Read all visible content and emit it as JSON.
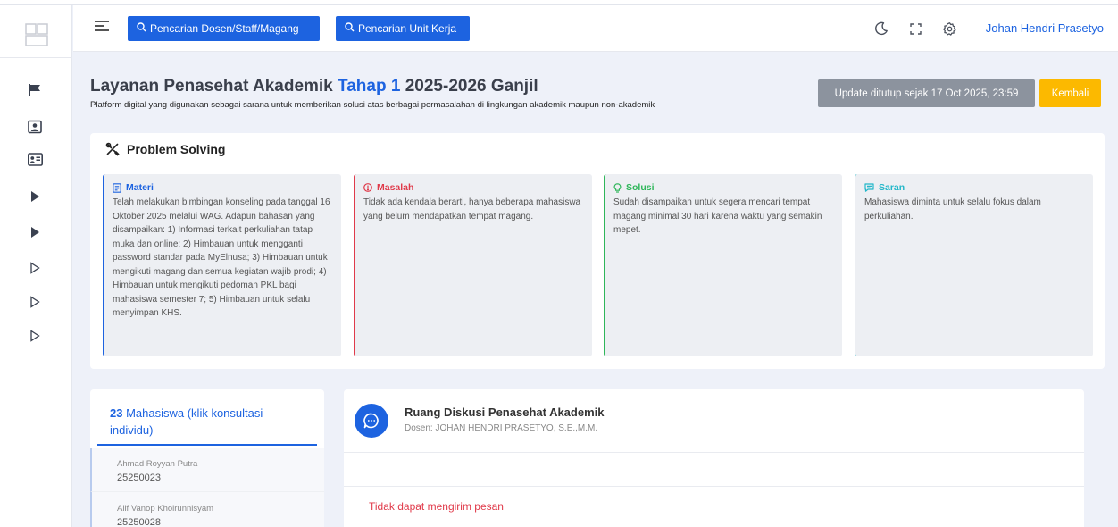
{
  "header": {
    "search_staff_label": "Pencarian Dosen/Staff/Magang",
    "search_unit_label": "Pencarian Unit Kerja",
    "username": "Johan Hendri Prasetyo"
  },
  "page": {
    "title_prefix": "Layanan Penasehat Akademik",
    "title_highlight": "Tahap 1",
    "title_suffix": "2025-2026 Ganjil",
    "subtitle": "Platform digital yang digunakan sebagai sarana untuk memberikan solusi atas berbagai permasalahan di lingkungan akademik maupun non-akademik",
    "closed_label": "Update ditutup sejak 17 Oct 2025, 23:59",
    "back_label": "Kembali"
  },
  "problem_solving": {
    "title": "Problem Solving",
    "materi": {
      "label": "Materi",
      "text": "Telah melakukan bimbingan konseling pada tanggal 16 Oktober 2025 melalui WAG. Adapun bahasan yang disampaikan: 1) Informasi terkait perkuliahan tatap muka dan online; 2) Himbauan untuk mengganti password standar pada MyElnusa; 3) Himbauan untuk mengikuti magang dan semua kegiatan wajib prodi; 4) Himbauan untuk mengikuti pedoman PKL bagi mahasiswa semester 7; 5) Himbauan untuk selalu menyimpan KHS."
    },
    "masalah": {
      "label": "Masalah",
      "text": "Tidak ada kendala berarti, hanya beberapa mahasiswa yang belum mendapatkan tempat magang."
    },
    "solusi": {
      "label": "Solusi",
      "text": "Sudah disampaikan untuk segera mencari tempat magang minimal 30 hari karena waktu yang semakin mepet."
    },
    "saran": {
      "label": "Saran",
      "text": "Mahasiswa diminta untuk selalu fokus dalam perkuliahan."
    }
  },
  "students": {
    "count": "23",
    "label": "Mahasiswa (klik konsultasi individu)",
    "items": [
      {
        "name": "Ahmad Royyan Putra",
        "id": "25250023"
      },
      {
        "name": "Alif Vanop Khoirunnisyam",
        "id": "25250028"
      }
    ]
  },
  "chat": {
    "title": "Ruang Diskusi Penasehat Akademik",
    "subtitle": "Dosen: JOHAN HENDRI PRASETYO, S.E.,M.M.",
    "error": "Tidak dapat mengirim pesan"
  },
  "colors": {
    "primary": "#1d63e0",
    "warning": "#fcb900",
    "danger": "#e03a4a",
    "success": "#2fb65a",
    "info": "#23b7c9",
    "muted": "#8c939e"
  },
  "icons": {
    "sidebar": [
      "flag-icon",
      "id-badge-icon",
      "id-card-icon",
      "caret-right-filled-icon",
      "caret-right-filled-icon",
      "caret-right-outline-icon",
      "caret-right-outline-icon",
      "caret-right-outline-icon"
    ],
    "header": [
      "menu-icon",
      "search-icon",
      "moon-icon",
      "fullscreen-icon",
      "gear-icon"
    ]
  }
}
